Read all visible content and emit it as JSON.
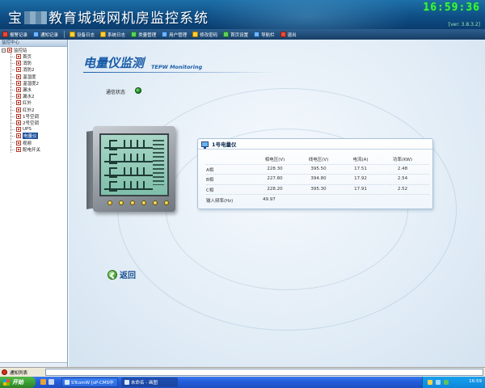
{
  "window": {
    "title_prefix": "宝",
    "title_suffix": "教育城域网机房监控系统",
    "clock": "16:59:36",
    "version": "[ver: 3.8.3.2]"
  },
  "toolbar": {
    "items": [
      {
        "label": "报警记录",
        "icon": "alarm-record-icon"
      },
      {
        "label": "通知记录",
        "icon": "notice-record-icon"
      },
      {
        "label": "设备日志",
        "icon": "device-log-icon"
      },
      {
        "label": "系统日志",
        "icon": "system-log-icon"
      },
      {
        "label": "类量管理",
        "icon": "category-icon"
      },
      {
        "label": "用户管理",
        "icon": "user-icon"
      },
      {
        "label": "修改密码",
        "icon": "key-icon"
      },
      {
        "label": "首页设置",
        "icon": "home-settings-icon"
      },
      {
        "label": "导航栏",
        "icon": "navbar-icon"
      },
      {
        "label": "退出",
        "icon": "exit-icon"
      }
    ]
  },
  "sidebar": {
    "header": "监控中心",
    "root": "监控站",
    "items": [
      {
        "label": "首页"
      },
      {
        "label": "消防"
      },
      {
        "label": "消防2"
      },
      {
        "label": "温湿度"
      },
      {
        "label": "温湿度2"
      },
      {
        "label": "漏水"
      },
      {
        "label": "漏水2"
      },
      {
        "label": "红外"
      },
      {
        "label": "红外2"
      },
      {
        "label": "1号空调"
      },
      {
        "label": "2号空调"
      },
      {
        "label": "UPS"
      },
      {
        "label": "电量仪",
        "selected": true
      },
      {
        "label": "视频"
      },
      {
        "label": "配电开关"
      }
    ]
  },
  "main": {
    "title": "电量仪监测",
    "subtitle": "TEPW Monitoring",
    "comm_label": "通信状态",
    "comm_status_color": "#1f9a1f",
    "panel": {
      "title": "1号电量仪",
      "headers": [
        "",
        "相电压(V)",
        "线电压(V)",
        "电流(A)",
        "功率(KW)"
      ],
      "rows": [
        [
          "A相",
          "228.30",
          "395.50",
          "17.51",
          "2.48"
        ],
        [
          "B相",
          "227.80",
          "394.80",
          "17.92",
          "2.54"
        ],
        [
          "C相",
          "228.20",
          "395.30",
          "17.91",
          "2.52"
        ]
      ],
      "freq_label": "输入频率(Hz)",
      "freq_value": "49.97"
    },
    "back_label": "返回"
  },
  "notification_bar": {
    "label": "通知列表"
  },
  "taskbar": {
    "start_label": "开始",
    "tasks": [
      {
        "label": "STcomW [sP-CMS中"
      },
      {
        "label": "未命名 - 画图"
      }
    ],
    "clock": "16:59"
  },
  "colors": {
    "title_bar": "#0f4f86",
    "accent_title": "#1a5ca8",
    "clock_green": "#42f442",
    "selected_bg": "#1c4f9c",
    "taskbar": "#245edb",
    "start_green": "#3a9c31"
  }
}
